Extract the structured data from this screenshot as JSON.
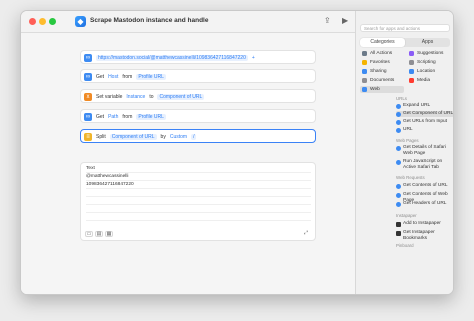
{
  "window": {
    "title": "Scrape Mastodon instance and handle"
  },
  "colors": {
    "accent": "#2f7ff5",
    "selection": "#3b82f6",
    "close": "#ff5f57",
    "minimize": "#febc2e",
    "zoom": "#28c840",
    "variable_icon": "#f08a24",
    "url_icon": "#3d8bf2"
  },
  "icons": {
    "app": "shortcuts-icon",
    "share": "share-icon",
    "run": "play-icon",
    "library": "library-icon",
    "info": "info-icon"
  },
  "editor": {
    "actions": [
      {
        "text": "https://mastodon.social/@matthewcassinelli/109836427116847220",
        "suffix": "+"
      },
      {
        "verb": "Get",
        "param": "Host",
        "from": "from",
        "input": "Profile URL"
      },
      {
        "verb": "Set variable",
        "param": "Instance",
        "to": "to",
        "input": "Component of URL"
      },
      {
        "verb": "Get",
        "param": "Path",
        "from": "from",
        "input": "Profile URL"
      },
      {
        "verb": "Split",
        "param": "Component of URL",
        "by": "by",
        "input": "Custom",
        "custom": "/"
      }
    ],
    "output": {
      "lines": [
        "Text",
        "@matthewcassinelli",
        "109836427116847220"
      ]
    },
    "footer": {
      "view_list": "list",
      "view_grid": "grid"
    }
  },
  "sidebar": {
    "search_placeholder": "Search for apps and actions",
    "tabs": {
      "categories": "Categories",
      "apps": "Apps"
    },
    "categories": [
      "All Actions",
      "Suggestions",
      "Favorites",
      "Scripting",
      "Sharing",
      "Location",
      "Documents",
      "Media",
      "Web"
    ],
    "sections": [
      {
        "title": "URLs",
        "items": [
          "Expand URL",
          "Get Component of URL",
          "Get URLs from Input",
          "URL"
        ]
      },
      {
        "title": "Web Pages",
        "items": [
          "Get Details of Safari Web Page",
          "Run JavaScript on Active Safari Tab"
        ]
      },
      {
        "title": "Web Requests",
        "items": [
          "Get Contents of URL",
          "Get Contents of Web Page",
          "Get Headers of URL"
        ]
      },
      {
        "title": "Instapaper",
        "items": [
          "Add to Instapaper",
          "Get Instapaper Bookmarks"
        ]
      },
      {
        "title": "Pinboard",
        "items": []
      }
    ]
  }
}
